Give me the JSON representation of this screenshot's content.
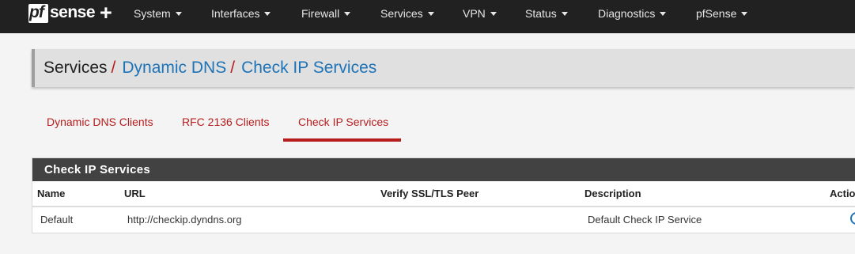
{
  "brand": {
    "logo_pf": "pf",
    "logo_sense": "sense",
    "logo_plus": "+"
  },
  "nav": [
    {
      "label": "System"
    },
    {
      "label": "Interfaces"
    },
    {
      "label": "Firewall"
    },
    {
      "label": "Services"
    },
    {
      "label": "VPN"
    },
    {
      "label": "Status"
    },
    {
      "label": "Diagnostics"
    },
    {
      "label": "pfSense"
    }
  ],
  "breadcrumb": {
    "root": "Services",
    "separator": "/",
    "level2": "Dynamic DNS",
    "current": "Check IP Services"
  },
  "tabs": [
    {
      "label": "Dynamic DNS Clients",
      "active": false
    },
    {
      "label": "RFC 2136 Clients",
      "active": false
    },
    {
      "label": "Check IP Services",
      "active": true
    }
  ],
  "panel": {
    "title": "Check IP Services",
    "columns": [
      "Name",
      "URL",
      "Verify SSL/TLS Peer",
      "Description",
      "Actio"
    ],
    "rows": [
      {
        "name": "Default",
        "url": "http://checkip.dyndns.org",
        "verify": "",
        "description": "Default Check IP Service",
        "action_icon": "clock-icon"
      }
    ]
  },
  "colors": {
    "navbar": "#212121",
    "accent_red": "#b71c1c",
    "link_blue": "#1e73b7",
    "panel_header": "#424242"
  }
}
